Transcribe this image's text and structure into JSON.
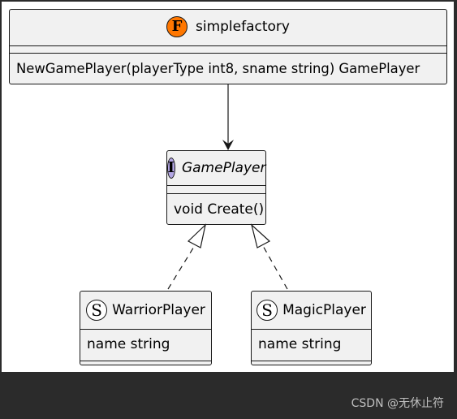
{
  "nodes": {
    "factory": {
      "stereotype_letter": "F",
      "name": "simplefactory",
      "method": "NewGamePlayer(playerType int8, sname string) GamePlayer",
      "badge_color": "#ff7700"
    },
    "interface": {
      "stereotype_letter": "I",
      "name": "GamePlayer",
      "method": "void Create()",
      "badge_color": "#b4a7e5"
    },
    "warrior": {
      "stereotype_letter": "S",
      "name": "WarriorPlayer",
      "field": "name string"
    },
    "magic": {
      "stereotype_letter": "S",
      "name": "MagicPlayer",
      "field": "name string"
    }
  },
  "watermark": "CSDN @无休止符"
}
